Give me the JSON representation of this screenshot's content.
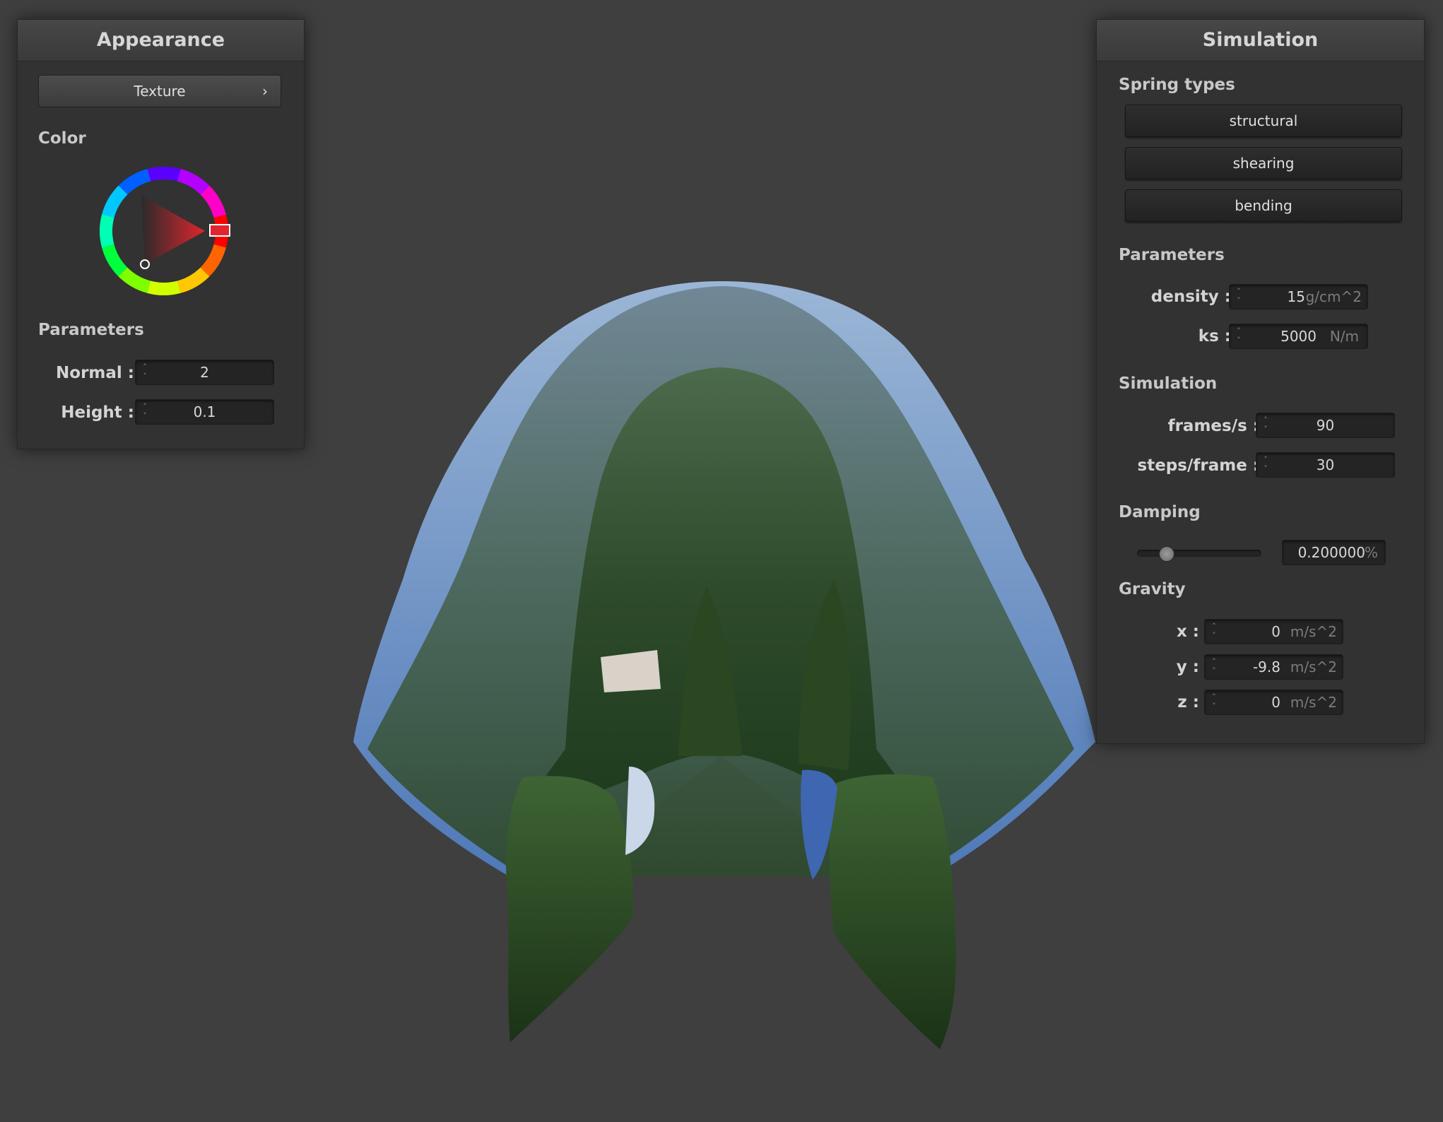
{
  "colors": {
    "background": "#3f3f3f",
    "panel": "#323232",
    "header": "#444444",
    "selected_color": "#d9262e"
  },
  "appearance": {
    "title": "Appearance",
    "texture_button": "Texture",
    "texture_chevron": "›",
    "color_label": "Color",
    "parameters_label": "Parameters",
    "normal": {
      "label": "Normal :",
      "value": "2"
    },
    "height": {
      "label": "Height :",
      "value": "0.1"
    }
  },
  "simulation": {
    "title": "Simulation",
    "spring_types_label": "Spring types",
    "spring_buttons": [
      "structural",
      "shearing",
      "bending"
    ],
    "parameters_label": "Parameters",
    "density": {
      "label": "density :",
      "value": "15",
      "unit": "g/cm^2"
    },
    "ks": {
      "label": "ks :",
      "value": "5000",
      "unit": "N/m"
    },
    "simulation_label": "Simulation",
    "frames": {
      "label": "frames/s :",
      "value": "90"
    },
    "steps": {
      "label": "steps/frame :",
      "value": "30"
    },
    "damping_label": "Damping",
    "damping": {
      "value": "0.200000",
      "unit": "%",
      "slider_level": 0.2
    },
    "gravity_label": "Gravity",
    "gravity_x": {
      "label": "x :",
      "value": "0",
      "unit": "m/s^2"
    },
    "gravity_y": {
      "label": "y :",
      "value": "-9.8",
      "unit": "m/s^2"
    },
    "gravity_z": {
      "label": "z :",
      "value": "0",
      "unit": "m/s^2"
    }
  },
  "icons": {
    "spinner": "spinner-arrows-icon",
    "chevron": "chevron-right-icon",
    "color_wheel": "color-wheel-icon"
  }
}
